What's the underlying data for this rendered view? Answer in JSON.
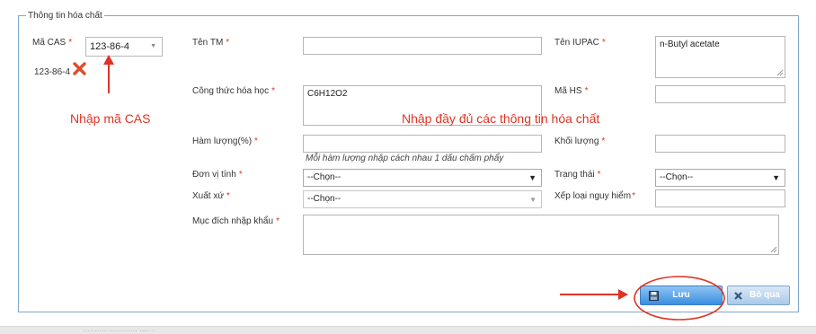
{
  "section": {
    "legend": "Thông tin hóa chất"
  },
  "cas": {
    "label": "Mã CAS",
    "selected": "123-86-4",
    "tag": "123-86-4"
  },
  "fields": {
    "ten_tm": {
      "label": "Tên TM",
      "value": ""
    },
    "ten_iupac": {
      "label": "Tên IUPAC",
      "value": "n-Butyl acetate"
    },
    "cong_thuc": {
      "label": "Công thức hóa học",
      "value": "C6H12O2"
    },
    "ma_hs": {
      "label": "Mã HS",
      "value": ""
    },
    "ham_luong": {
      "label": "Hàm lượng(%)",
      "value": "",
      "note": "Mỗi hàm lượng nhập cách nhau 1 dấu chấm phẩy"
    },
    "khoi_luong": {
      "label": "Khối lượng",
      "value": ""
    },
    "don_vi_tinh": {
      "label": "Đơn vị tính",
      "selected": "--Chọn--"
    },
    "trang_thai": {
      "label": "Trạng thái",
      "selected": "--Chọn--"
    },
    "xuat_xu": {
      "label": "Xuất xứ",
      "selected": "--Chọn--"
    },
    "xep_loai": {
      "label": "Xếp loại nguy hiểm",
      "value": ""
    },
    "muc_dich": {
      "label": "Mục đích nhập khẩu",
      "value": ""
    }
  },
  "required_mark": "*",
  "annotations": {
    "enter_cas": "Nhập mã CAS",
    "fill_info": "Nhập đầy đủ các thông tin hóa chất",
    "color": "#e03323"
  },
  "buttons": {
    "save": "Lưu",
    "skip": "Bỏ qua"
  },
  "colors": {
    "accent": "#3a8ee0",
    "border": "#7fa6cc",
    "required": "#d9362b"
  }
}
